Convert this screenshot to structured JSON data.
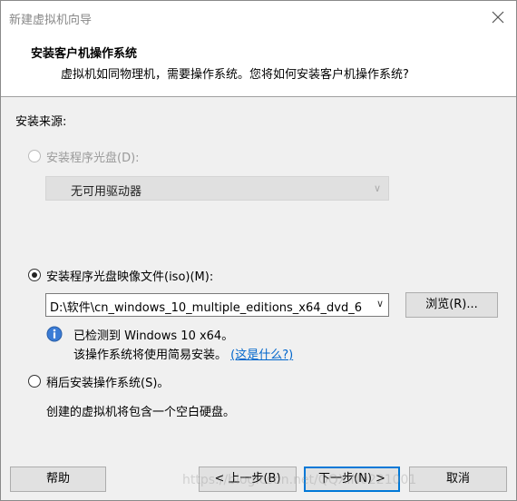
{
  "window": {
    "title": "新建虚拟机向导"
  },
  "header": {
    "title": "安装客户机操作系统",
    "subtitle": "虚拟机如同物理机，需要操作系统。您将如何安装客户机操作系统?"
  },
  "source": {
    "label": "安装来源:",
    "disc_option": {
      "label": "安装程序光盘(D):",
      "enabled": false,
      "selected": false,
      "drive_combo_value": "无可用驱动器"
    },
    "iso_option": {
      "label": "安装程序光盘映像文件(iso)(M):",
      "selected": true,
      "path_value": "D:\\软件\\cn_windows_10_multiple_editions_x64_dvd_6",
      "browse_label": "浏览(R)...",
      "detected_text": "已检测到 Windows 10 x64。",
      "easy_install_text": "该操作系统将使用简易安装。",
      "what_is_link": "(这是什么?)"
    },
    "later_option": {
      "label": "稍后安装操作系统(S)。",
      "selected": false,
      "description": "创建的虚拟机将包含一个空白硬盘。"
    }
  },
  "footer": {
    "help_label": "帮助",
    "back_label": "< 上一步(B)",
    "next_label": "下一步(N) >",
    "cancel_label": "取消"
  },
  "watermark": "https://blog.csdn.net/QQXIN0221001",
  "icons": {
    "close": "close-icon",
    "info": "info-icon",
    "chevron": "chevron-down-icon"
  }
}
